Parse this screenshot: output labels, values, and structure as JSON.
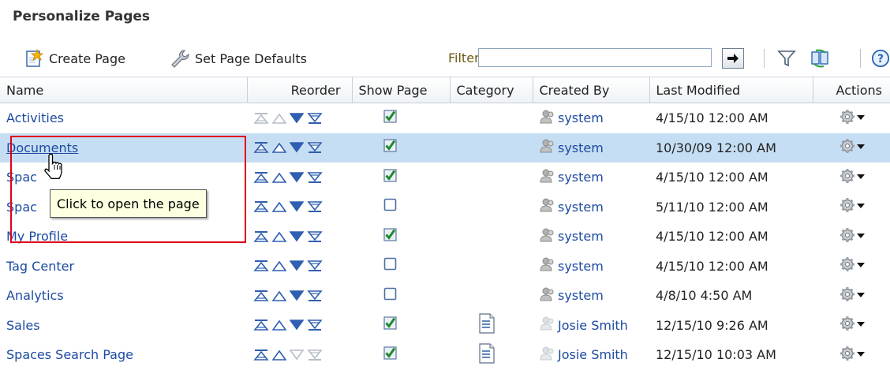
{
  "page_title": "Personalize Pages",
  "toolbar": {
    "create_label": "Create Page",
    "defaults_label": "Set Page Defaults",
    "filter_label": "Filter",
    "filter_value": ""
  },
  "columns": {
    "name": "Name",
    "reorder": "Reorder",
    "show_page": "Show Page",
    "category": "Category",
    "created_by": "Created By",
    "last_modified": "Last Modified",
    "actions": "Actions"
  },
  "rows": [
    {
      "name": "Activities",
      "created_by": "system",
      "last_modified": "4/15/10 12:00 AM"
    },
    {
      "name": "Documents",
      "created_by": "system",
      "last_modified": "10/30/09 12:00 AM"
    },
    {
      "name": "Spac",
      "created_by": "system",
      "last_modified": "4/15/10 12:00 AM"
    },
    {
      "name": "Spac",
      "created_by": "system",
      "last_modified": "5/11/10 12:00 AM"
    },
    {
      "name": "My Profile",
      "created_by": "system",
      "last_modified": "4/15/10 12:00 AM"
    },
    {
      "name": "Tag Center",
      "created_by": "system",
      "last_modified": "4/15/10 12:00 AM"
    },
    {
      "name": "Analytics",
      "created_by": "system",
      "last_modified": "4/8/10 4:50 AM"
    },
    {
      "name": "Sales",
      "created_by": "Josie Smith",
      "last_modified": "12/15/10 9:26 AM"
    },
    {
      "name": "Spaces Search Page",
      "created_by": "Josie Smith",
      "last_modified": "12/15/10 10:03 AM"
    }
  ],
  "tooltip": "Click to open the page",
  "colors": {
    "link": "#1d4ba2",
    "selected_row": "#c6def3",
    "highlight": "#e0001b",
    "reorder_active": "#2f5fb0",
    "reorder_disabled": "#b5bcc6"
  },
  "icons": {
    "create": "create-page-icon",
    "defaults": "wrench-icon",
    "go": "arrow-right-icon",
    "filter": "funnel-icon",
    "refresh": "refresh-icon",
    "help": "help-icon",
    "show": "checkbox-icon",
    "category": "document-icon",
    "creator": "user-icon",
    "actions": "gear-menu-icon"
  }
}
